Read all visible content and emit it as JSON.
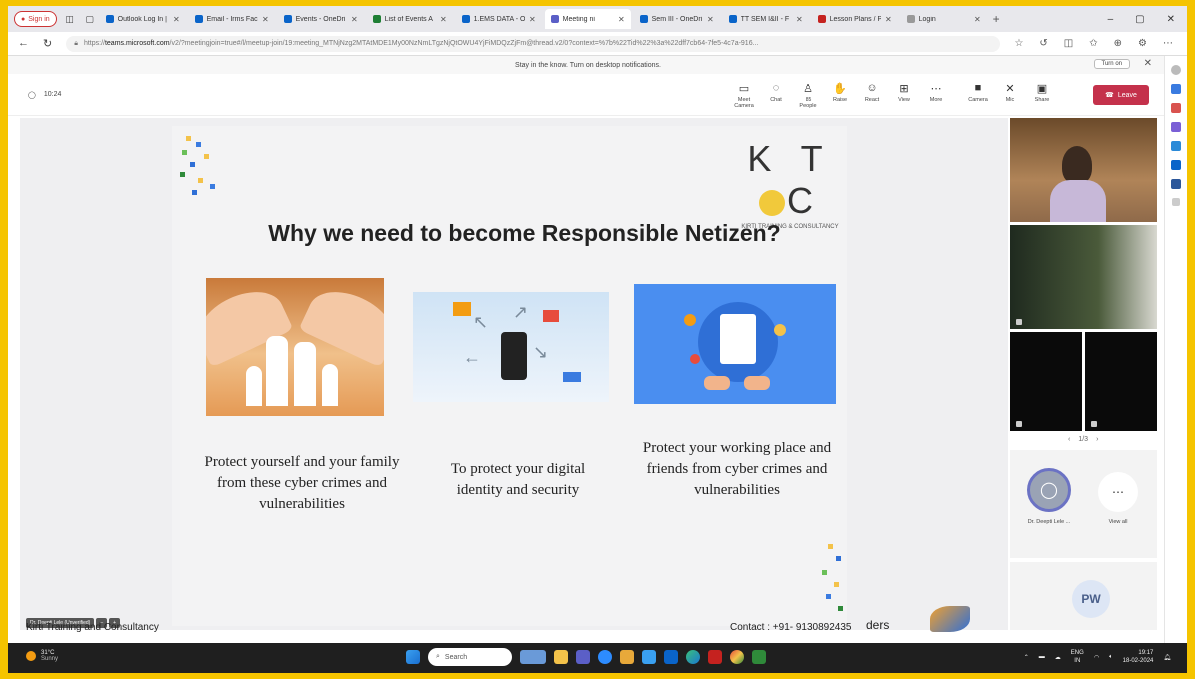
{
  "browser": {
    "signin_label": "Sign in",
    "tabs": [
      {
        "label": "Outlook Log In |",
        "color": "#0a64c9"
      },
      {
        "label": "Email - Irms Fac",
        "color": "#0a64c9"
      },
      {
        "label": "Events - OneDri",
        "color": "#0a64c9"
      },
      {
        "label": "List of Events A",
        "color": "#1e7e34"
      },
      {
        "label": "1.EMS DATA - O",
        "color": "#0a64c9"
      },
      {
        "label": "Meeting ni",
        "color": "#5b5fc7"
      },
      {
        "label": "Sem III - OneDri",
        "color": "#0a64c9"
      },
      {
        "label": "TT SEM I&II - F",
        "color": "#0a64c9"
      },
      {
        "label": "Lesson Plans / P",
        "color": "#c5221f"
      },
      {
        "label": "Login",
        "color": "#999999"
      }
    ],
    "url_host": "teams.microsoft.com",
    "url_prefix": "https://",
    "url_rest": "/v2/?meetingjoin=true#/l/meetup-join/19:meeting_MTNjNzg2MTAtMDE1My00NzNmLTgzNjQtOWU4YjFiMDQzZjFm@thread.v2/0?context=%7b%22Tid%22%3a%22dff7cb64-7fe5-4c7a-916...",
    "notification": "Stay in the know. Turn on desktop notifications.",
    "notification_button": "Turn on"
  },
  "meeting": {
    "timer": "10:24",
    "controls": [
      {
        "label": "Meet Camera",
        "icon": "▭"
      },
      {
        "label": "Chat",
        "icon": "◌"
      },
      {
        "label": "People",
        "icon": "♙",
        "badge": "85"
      },
      {
        "label": "Raise",
        "icon": "✋"
      },
      {
        "label": "React",
        "icon": "☺"
      },
      {
        "label": "View",
        "icon": "⊞"
      },
      {
        "label": "More",
        "icon": "⋯"
      }
    ],
    "media": [
      {
        "label": "Camera",
        "icon": "■"
      },
      {
        "label": "Mic",
        "icon": "✕"
      },
      {
        "label": "Share",
        "icon": "▣"
      }
    ],
    "leave_label": "Leave",
    "presenter_chip": "Dr. Deepti Lele (Unverified)"
  },
  "slide": {
    "brand": "KTC",
    "brand_sub": "KIRTI TRAINING & CONSULTANCY",
    "title": "Why we need to become Responsible Netizen?",
    "captions": [
      "Protect yourself and your family from these cyber crimes and vulnerabilities",
      "To  protect your digital identity and security",
      "Protect your working place and friends from cyber crimes and vulnerabilities"
    ],
    "footer_left": "Kirti Training and Consultancy",
    "footer_contact": "Contact : +91- 9130892435",
    "footer_right": "ders"
  },
  "participants": {
    "pager": "1/3",
    "presenter_name": "Dr. Deepti Lele ...",
    "view_all": "View all",
    "initials": "PW"
  },
  "taskbar": {
    "temp": "31°C",
    "weather": "Sunny",
    "search": "Search",
    "lang": "ENG",
    "lang_sub": "IN",
    "time": "19:17",
    "date": "18-02-2024"
  }
}
